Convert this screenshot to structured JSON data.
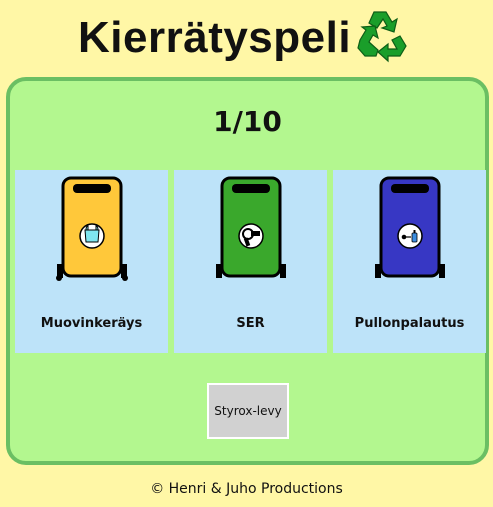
{
  "header": {
    "title": "Kierrätyspeli",
    "logo_icon": "recycle-icon"
  },
  "game": {
    "progress": "1/10",
    "bins": [
      {
        "label": "Muovinkeräys",
        "color": "#ffc83a",
        "icon": "plastic-bag-icon"
      },
      {
        "label": "SER",
        "color": "#3aa82c",
        "icon": "hair-dryer-icon"
      },
      {
        "label": "Pullonpalautus",
        "color": "#3737c4",
        "icon": "bottle-can-icon"
      }
    ],
    "current_item": "Styrox-levy"
  },
  "footer": {
    "credit": "© Henri & Juho Productions"
  },
  "colors": {
    "background": "#fff7a6",
    "panel": "#b3f78f",
    "panel_border": "#6bbf63",
    "bin_slot": "#bde3f9",
    "item_card": "#d1d1d1",
    "recycle_green": "#1a9e2a"
  }
}
